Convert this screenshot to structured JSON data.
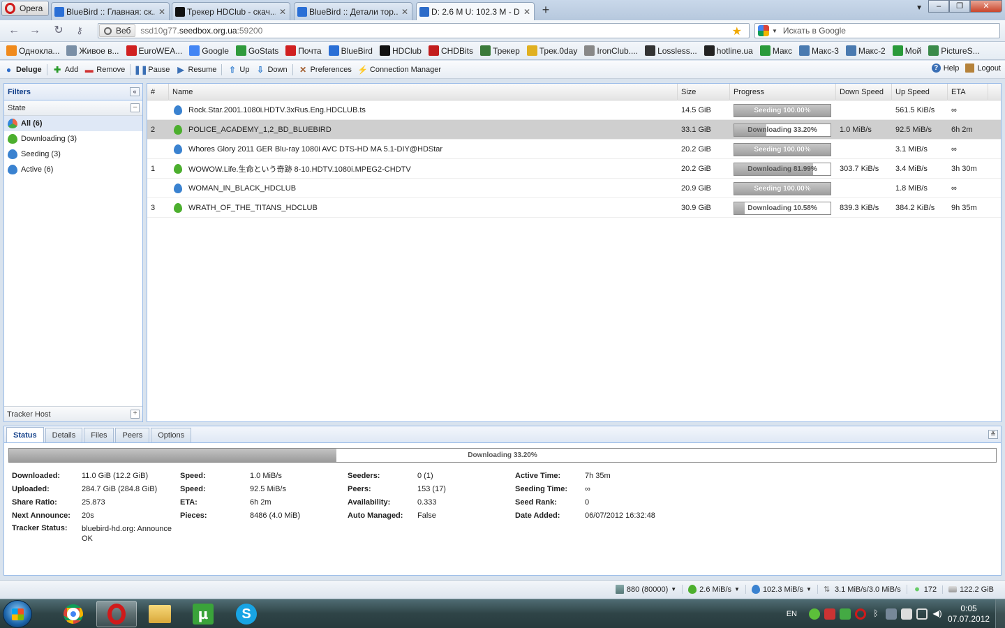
{
  "browser": {
    "menu_label": "Opera",
    "tabs": [
      {
        "title": "BlueBird :: Главная: ск...",
        "color": "#2a6fd6"
      },
      {
        "title": "Трекер HDClub - скач...",
        "color": "#111111"
      },
      {
        "title": "BlueBird :: Детали тор...",
        "color": "#2a6fd6"
      },
      {
        "title": "D: 2.6 M U: 102.3 M - D...",
        "color": "#2d6cc9"
      }
    ],
    "web_badge": "Веб",
    "url_prefix": "ssd10g77.",
    "url_host": "seedbox.org.ua",
    "url_suffix": ":59200",
    "search_placeholder": "Искать в Google"
  },
  "bookmarks": [
    {
      "label": "Одноклa...",
      "color": "#f08a1c"
    },
    {
      "label": "Живое в...",
      "color": "#7a8fa6"
    },
    {
      "label": "EuroWEA...",
      "color": "#d02020"
    },
    {
      "label": "Google",
      "color": "#4285f4"
    },
    {
      "label": "GoStats",
      "color": "#2f9a3c"
    },
    {
      "label": "Почта",
      "color": "#d02020"
    },
    {
      "label": "BlueBird",
      "color": "#2a6fd6"
    },
    {
      "label": "HDClub",
      "color": "#111111"
    },
    {
      "label": "CHDBits",
      "color": "#c21d1d"
    },
    {
      "label": "Трекер",
      "color": "#3a7a3a"
    },
    {
      "label": "Трек.0day",
      "color": "#e0b020"
    },
    {
      "label": "IronClub....",
      "color": "#888888"
    },
    {
      "label": "Lossless...",
      "color": "#333333"
    },
    {
      "label": "hotline.ua",
      "color": "#222222"
    },
    {
      "label": "Макс",
      "color": "#2a9a3a"
    },
    {
      "label": "Макс-3",
      "color": "#4a7ab0"
    },
    {
      "label": "Макс-2",
      "color": "#4a7ab0"
    },
    {
      "label": "Мой",
      "color": "#2a9a3a"
    },
    {
      "label": "PictureS...",
      "color": "#3a8a4a"
    }
  ],
  "toolbar": {
    "brand": "Deluge",
    "add": "Add",
    "remove": "Remove",
    "pause": "Pause",
    "resume": "Resume",
    "up": "Up",
    "down": "Down",
    "preferences": "Preferences",
    "connection_manager": "Connection Manager",
    "help": "Help",
    "logout": "Logout"
  },
  "filters": {
    "title": "Filters",
    "state_label": "State",
    "items": [
      {
        "label": "All (6)",
        "selected": true
      },
      {
        "label": "Downloading (3)",
        "selected": false
      },
      {
        "label": "Seeding (3)",
        "selected": false
      },
      {
        "label": "Active (6)",
        "selected": false
      }
    ],
    "tracker_host": "Tracker Host"
  },
  "grid": {
    "columns": [
      "#",
      "Name",
      "Size",
      "Progress",
      "Down Speed",
      "Up Speed",
      "ETA"
    ],
    "rows": [
      {
        "num": "",
        "name": "Rock.Star.2001.1080i.HDTV.3xRus.Eng.HDCLUB.ts",
        "size": "14.5 GiB",
        "progress": 1.0,
        "progress_label": "Seeding 100.00%",
        "state": "seeding",
        "down": "",
        "up": "561.5 KiB/s",
        "eta": "∞"
      },
      {
        "num": "2",
        "name": "POLICE_ACADEMY_1,2_BD_BLUEBIRD",
        "size": "33.1 GiB",
        "progress": 0.332,
        "progress_label": "Downloading 33.20%",
        "state": "downloading",
        "down": "1.0 MiB/s",
        "up": "92.5 MiB/s",
        "eta": "6h 2m",
        "selected": true
      },
      {
        "num": "",
        "name": "Whores Glory 2011 GER Blu-ray 1080i AVC DTS-HD MA 5.1-DIY@HDStar",
        "size": "20.2 GiB",
        "progress": 1.0,
        "progress_label": "Seeding 100.00%",
        "state": "seeding",
        "down": "",
        "up": "3.1 MiB/s",
        "eta": "∞"
      },
      {
        "num": "1",
        "name": "WOWOW.Life.生命という奇跡 8-10.HDTV.1080i.MPEG2-CHDTV",
        "size": "20.2 GiB",
        "progress": 0.819,
        "progress_label": "Downloading 81.99%",
        "state": "downloading",
        "down": "303.7 KiB/s",
        "up": "3.4 MiB/s",
        "eta": "3h 30m"
      },
      {
        "num": "",
        "name": "WOMAN_IN_BLACK_HDCLUB",
        "size": "20.9 GiB",
        "progress": 1.0,
        "progress_label": "Seeding 100.00%",
        "state": "seeding",
        "down": "",
        "up": "1.8 MiB/s",
        "eta": "∞"
      },
      {
        "num": "3",
        "name": "WRATH_OF_THE_TITANS_HDCLUB",
        "size": "30.9 GiB",
        "progress": 0.1058,
        "progress_label": "Downloading 10.58%",
        "state": "downloading",
        "down": "839.3 KiB/s",
        "up": "384.2 KiB/s",
        "eta": "9h 35m"
      }
    ]
  },
  "details": {
    "tabs": [
      "Status",
      "Details",
      "Files",
      "Peers",
      "Options"
    ],
    "progress": 0.332,
    "progress_label": "Downloading 33.20%",
    "col1": [
      {
        "k": "Downloaded:",
        "v": "11.0 GiB (12.2 GiB)"
      },
      {
        "k": "Uploaded:",
        "v": "284.7 GiB (284.8 GiB)"
      },
      {
        "k": "Share Ratio:",
        "v": "25.873"
      },
      {
        "k": "Next Announce:",
        "v": "20s"
      },
      {
        "k": "Tracker Status:",
        "v": "bluebird-hd.org: Announce OK"
      }
    ],
    "col2": [
      {
        "k": "Speed:",
        "v": "1.0 MiB/s"
      },
      {
        "k": "Speed:",
        "v": "92.5 MiB/s"
      },
      {
        "k": "ETA:",
        "v": "6h 2m"
      },
      {
        "k": "Pieces:",
        "v": "8486 (4.0 MiB)"
      }
    ],
    "col3": [
      {
        "k": "Seeders:",
        "v": "0 (1)"
      },
      {
        "k": "Peers:",
        "v": "153 (17)"
      },
      {
        "k": "Availability:",
        "v": "0.333"
      },
      {
        "k": "Auto Managed:",
        "v": "False"
      }
    ],
    "col4": [
      {
        "k": "Active Time:",
        "v": "7h 35m"
      },
      {
        "k": "Seeding Time:",
        "v": "∞"
      },
      {
        "k": "Seed Rank:",
        "v": "0"
      },
      {
        "k": "Date Added:",
        "v": "06/07/2012 16:32:48"
      }
    ]
  },
  "statusbar": {
    "connections": "880 (80000)",
    "down_speed": "2.6 MiB/s",
    "up_speed": "102.3 MiB/s",
    "protocol": "3.1 MiB/s/3.0 MiB/s",
    "dht": "172",
    "free_space": "122.2 GiB"
  },
  "taskbar": {
    "language": "EN",
    "time": "0:05",
    "date": "07.07.2012"
  }
}
